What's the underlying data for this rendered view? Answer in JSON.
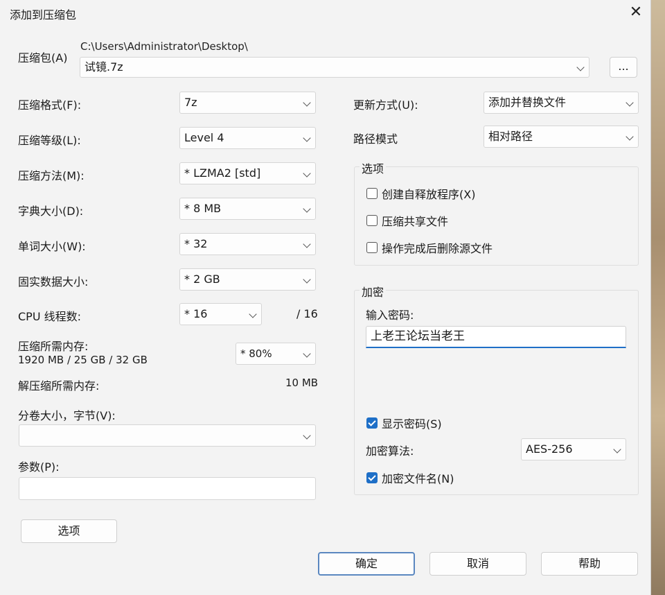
{
  "window": {
    "title": "添加到压缩包",
    "close_glyph": "✕"
  },
  "archive": {
    "label": "压缩包(A)",
    "path": "C:\\Users\\Administrator\\Desktop\\",
    "filename": "试镜.7z",
    "browse_label": "..."
  },
  "left": {
    "format": {
      "label": "压缩格式(F):",
      "value": "7z"
    },
    "level": {
      "label": "压缩等级(L):",
      "value": "Level 4"
    },
    "method": {
      "label": "压缩方法(M):",
      "value": "*  LZMA2 [std]"
    },
    "dict": {
      "label": "字典大小(D):",
      "value": "*  8 MB"
    },
    "word": {
      "label": "单词大小(W):",
      "value": "*  32"
    },
    "solid": {
      "label": "固实数据大小:",
      "value": "*  2 GB"
    },
    "cpu": {
      "label": "CPU 线程数:",
      "value": "*  16",
      "max": "/ 16"
    },
    "mem": {
      "label": "压缩所需内存:",
      "detail": "1920 MB / 25 GB / 32 GB",
      "value": "* 80%"
    },
    "decomp": {
      "label": "解压缩所需内存:",
      "value": "10 MB"
    },
    "volume": {
      "label": "分卷大小，字节(V):",
      "value": ""
    },
    "params": {
      "label": "参数(P):",
      "value": ""
    },
    "options_button": "选项"
  },
  "right": {
    "update": {
      "label": "更新方式(U):",
      "value": "添加并替换文件"
    },
    "path_mode": {
      "label": "路径模式",
      "value": "相对路径"
    },
    "options_group": {
      "title": "选项",
      "sfx": "创建自释放程序(X)",
      "shared": "压缩共享文件",
      "delete": "操作完成后删除源文件"
    },
    "encryption": {
      "title": "加密",
      "password_label": "输入密码:",
      "password_value": "上老王论坛当老王",
      "show_password": "显示密码(S)",
      "algo_label": "加密算法:",
      "algo_value": "AES-256",
      "encrypt_names": "加密文件名(N)"
    }
  },
  "buttons": {
    "ok": "确定",
    "cancel": "取消",
    "help": "帮助"
  }
}
